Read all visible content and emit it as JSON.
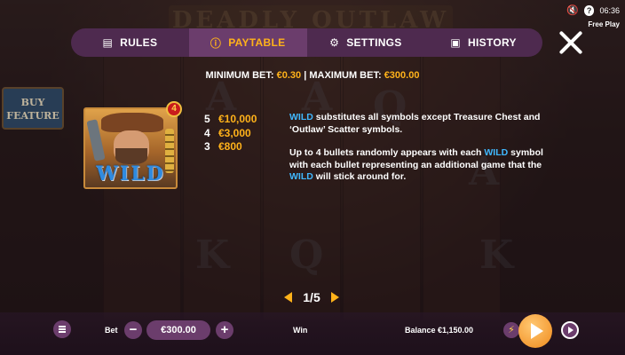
{
  "status": {
    "time": "06:36",
    "mode": "Free Play",
    "mute_icon": "speaker-muted-icon",
    "help_label": "?"
  },
  "side": {
    "buy_feature": "BUY FEATURE"
  },
  "tabs": [
    {
      "label": "RULES",
      "icon": "document-icon",
      "active": false
    },
    {
      "label": "PAYTABLE",
      "icon": "info-icon",
      "active": true
    },
    {
      "label": "SETTINGS",
      "icon": "gear-icon",
      "active": false
    },
    {
      "label": "HISTORY",
      "icon": "history-icon",
      "active": false
    }
  ],
  "limits": {
    "min_label": "MINIMUM BET:",
    "min_value": "€0.30",
    "separator": "|",
    "max_label": "MAXIMUM BET:",
    "max_value": "€300.00"
  },
  "symbol": {
    "name": "WILD",
    "badge": "4"
  },
  "payouts": [
    {
      "count": "5",
      "amount": "€10,000"
    },
    {
      "count": "4",
      "amount": "€3,000"
    },
    {
      "count": "3",
      "amount": "€800"
    }
  ],
  "description": {
    "p1_keyword": "WILD",
    "p1_text": " substitutes all symbols except Treasure Chest and ‘Outlaw’ Scatter symbols.",
    "p2_text_a": " Up to 4 bullets randomly appears with each ",
    "p2_keyword_a": "WILD",
    "p2_text_b": " symbol with each bullet representing an additional game that the ",
    "p2_keyword_b": "WILD",
    "p2_text_c": " will stick around for."
  },
  "pager": {
    "label": "1/5",
    "current": 1,
    "total": 5
  },
  "bottom": {
    "bet_label": "Bet",
    "bet_value": "€300.00",
    "minus_label": "−",
    "plus_label": "+",
    "win_label": "Win",
    "balance_label": "Balance",
    "balance_value": "€1,150.00",
    "turbo_label": "⚡"
  },
  "colors": {
    "accent": "#ffb21a",
    "keyword": "#40b8ff",
    "panel": "#4e2a4f",
    "panel_active": "#6b3d6c"
  }
}
